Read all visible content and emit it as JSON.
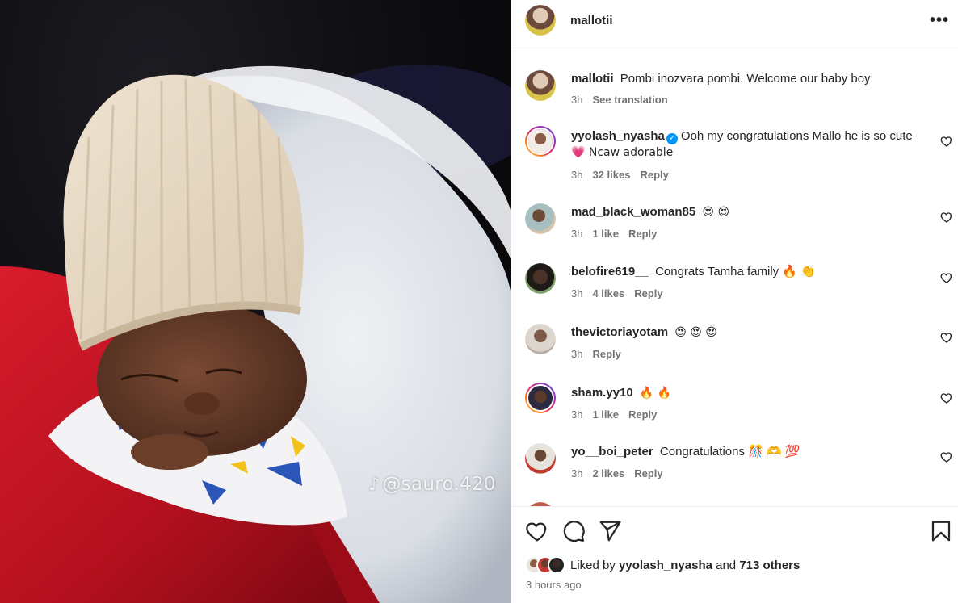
{
  "post": {
    "author": "mallotii",
    "more_label": "•••",
    "watermark": "@sauro.420",
    "watermark_icon": "tiktok-icon"
  },
  "caption": {
    "username": "mallotii",
    "text": "Pombi inozvara pombi. Welcome our baby boy",
    "time": "3h",
    "translate_label": "See translation"
  },
  "comments": [
    {
      "username": "yyolash_nyasha",
      "verified": true,
      "text": "Ooh my congratulations Mallo he is so cute",
      "text2": "💗 Ncaw adorable",
      "time": "3h",
      "likes": "32 likes",
      "reply": "Reply",
      "avatar_color": "#6b4a3a",
      "ring": true
    },
    {
      "username": "mad_black_woman85",
      "text": "😍 😍",
      "time": "3h",
      "likes": "1 like",
      "reply": "Reply",
      "avatar_color": "#8aa1a6",
      "ring": false
    },
    {
      "username": "belofire619__",
      "text": "Congrats Tamha family 🔥 👏",
      "time": "3h",
      "likes": "4 likes",
      "reply": "Reply",
      "avatar_color": "#3a2f29",
      "ring": false
    },
    {
      "username": "thevictoriayotam",
      "text": "😍 😍 😍",
      "time": "3h",
      "likes": "",
      "reply": "Reply",
      "avatar_color": "#a99d93",
      "ring": false
    },
    {
      "username": "sham.yy10",
      "text": "🔥 🔥",
      "time": "3h",
      "likes": "1 like",
      "reply": "Reply",
      "avatar_color": "#2b2b38",
      "ring": true
    },
    {
      "username": "yo__boi_peter",
      "text": "Congratulations 🎊 🫶 💯",
      "time": "3h",
      "likes": "2 likes",
      "reply": "Reply",
      "avatar_color": "#c9c3bc",
      "ring": false
    }
  ],
  "actions": {
    "like_icon": "heart-icon",
    "comment_icon": "comment-icon",
    "share_icon": "send-icon",
    "save_icon": "bookmark-icon"
  },
  "likes": {
    "prefix": "Liked by",
    "user": "yyolash_nyasha",
    "and": "and",
    "others": "713 others"
  },
  "timestamp": "3 hours ago",
  "colors": {
    "text": "#262626",
    "muted": "#737373",
    "verified": "#0095f6",
    "border": "#dbdbdb"
  }
}
